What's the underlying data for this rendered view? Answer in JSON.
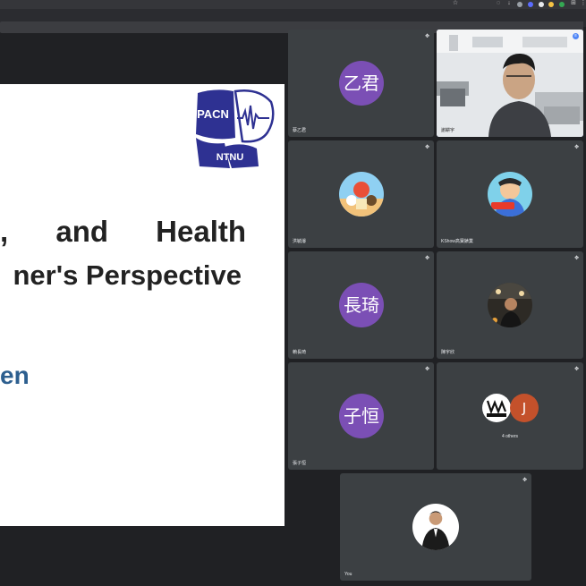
{
  "slide": {
    "title_line1": ", and Health",
    "title_line2": "ner's Perspective",
    "author_fragment": "en",
    "logo_top": "PACN",
    "logo_bottom": "NTNU"
  },
  "participants": [
    {
      "name": "蔡乙君",
      "initials": "乙君",
      "avatar_color": "#7b4fb5"
    },
    {
      "name": "謝耕宇",
      "type": "video"
    },
    {
      "name": "洪毓濬",
      "type": "picture"
    },
    {
      "name": "KShow高寶錶業",
      "type": "picture"
    },
    {
      "name": "賴長琦",
      "initials": "長琦",
      "avatar_color": "#7b4fb5"
    },
    {
      "name": "陳宇欣",
      "type": "picture"
    },
    {
      "name": "張子恒",
      "initials": "子恒",
      "avatar_color": "#7b4fb5"
    },
    {
      "others_label": "4 others",
      "avatar_letter": "J",
      "avatar_color": "#c4512b"
    },
    {
      "name": "You",
      "type": "picture"
    }
  ],
  "icons": {
    "pin": "push-pin-icon",
    "mic_active": "audio-active-icon"
  }
}
